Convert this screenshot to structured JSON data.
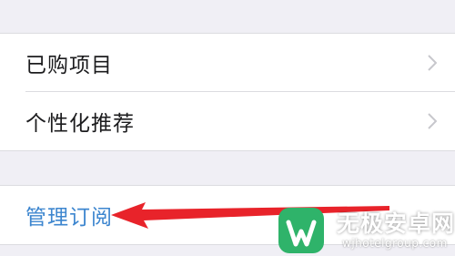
{
  "settings_list": {
    "items": [
      {
        "label": "已购项目",
        "icon": "chevron-right-icon"
      },
      {
        "label": "个性化推荐",
        "icon": "chevron-right-icon"
      }
    ],
    "manage_subscriptions_label": "管理订阅"
  },
  "annotation": {
    "arrow_color": "#e8232a"
  },
  "watermark": {
    "title": "无极安卓网",
    "url": "wjhotelgroup.com",
    "logo_color": "#2fb36a"
  },
  "colors": {
    "link_blue": "#3d86cf",
    "background": "#f0eff5",
    "cell_background": "#ffffff"
  }
}
